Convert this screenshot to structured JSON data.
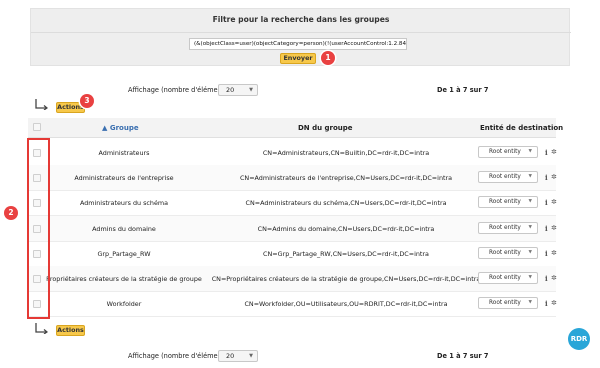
{
  "filter": {
    "title": "Filtre pour la recherche dans les groupes",
    "query_value": "(&(objectClass=user)(objectCategory=person)(!(userAccountControl:1.2.84",
    "send_label": "Envoyer"
  },
  "badges": {
    "send": "1",
    "checkboxes": "2",
    "actions": "3"
  },
  "top_controls": {
    "display_label": "Affichage (nombre d'éléments)",
    "display_value": "20",
    "pagination": "De 1 à 7 sur 7",
    "actions_label": "Actions"
  },
  "bottom_controls": {
    "display_label": "Affichage (nombre d'éléments)",
    "display_value": "20",
    "pagination": "De 1 à 7 sur 7",
    "actions_label": "Actions"
  },
  "table": {
    "headers": {
      "group": "Groupe",
      "dn": "DN du groupe",
      "entity": "Entité de destination"
    },
    "rows": [
      {
        "group": "Administrateurs",
        "dn": "CN=Administrateurs,CN=Builtin,DC=rdr-it,DC=intra",
        "entity": "Root entity"
      },
      {
        "group": "Administrateurs de l'entreprise",
        "dn": "CN=Administrateurs de l'entreprise,CN=Users,DC=rdr-it,DC=intra",
        "entity": "Root entity"
      },
      {
        "group": "Administrateurs du schéma",
        "dn": "CN=Administrateurs du schéma,CN=Users,DC=rdr-it,DC=intra",
        "entity": "Root entity"
      },
      {
        "group": "Admins du domaine",
        "dn": "CN=Admins du domaine,CN=Users,DC=rdr-it,DC=intra",
        "entity": "Root entity"
      },
      {
        "group": "Grp_Partage_RW",
        "dn": "CN=Grp_Partage_RW,CN=Users,DC=rdr-it,DC=intra",
        "entity": "Root entity"
      },
      {
        "group": "Propriétaires créateurs de la stratégie de groupe",
        "dn": "CN=Propriétaires créateurs de la stratégie de groupe,CN=Users,DC=rdr-it,DC=intra",
        "entity": "Root entity"
      },
      {
        "group": "Workfolder",
        "dn": "CN=Workfolder,OU=Utilisateurs,OU=RDRIT,DC=rdr-it,DC=intra",
        "entity": "Root entity"
      }
    ]
  },
  "watermark": {
    "text": "RDR"
  },
  "colors": {
    "accent_yellow": "#f7c84a",
    "badge_red": "#e94141",
    "highlight_red": "#e53935",
    "logo_blue": "#29a6d8"
  },
  "icons": [
    "corner-arrow-icon",
    "sort-arrow-icon",
    "caret-down-icon",
    "info-icon",
    "gear-icon"
  ]
}
